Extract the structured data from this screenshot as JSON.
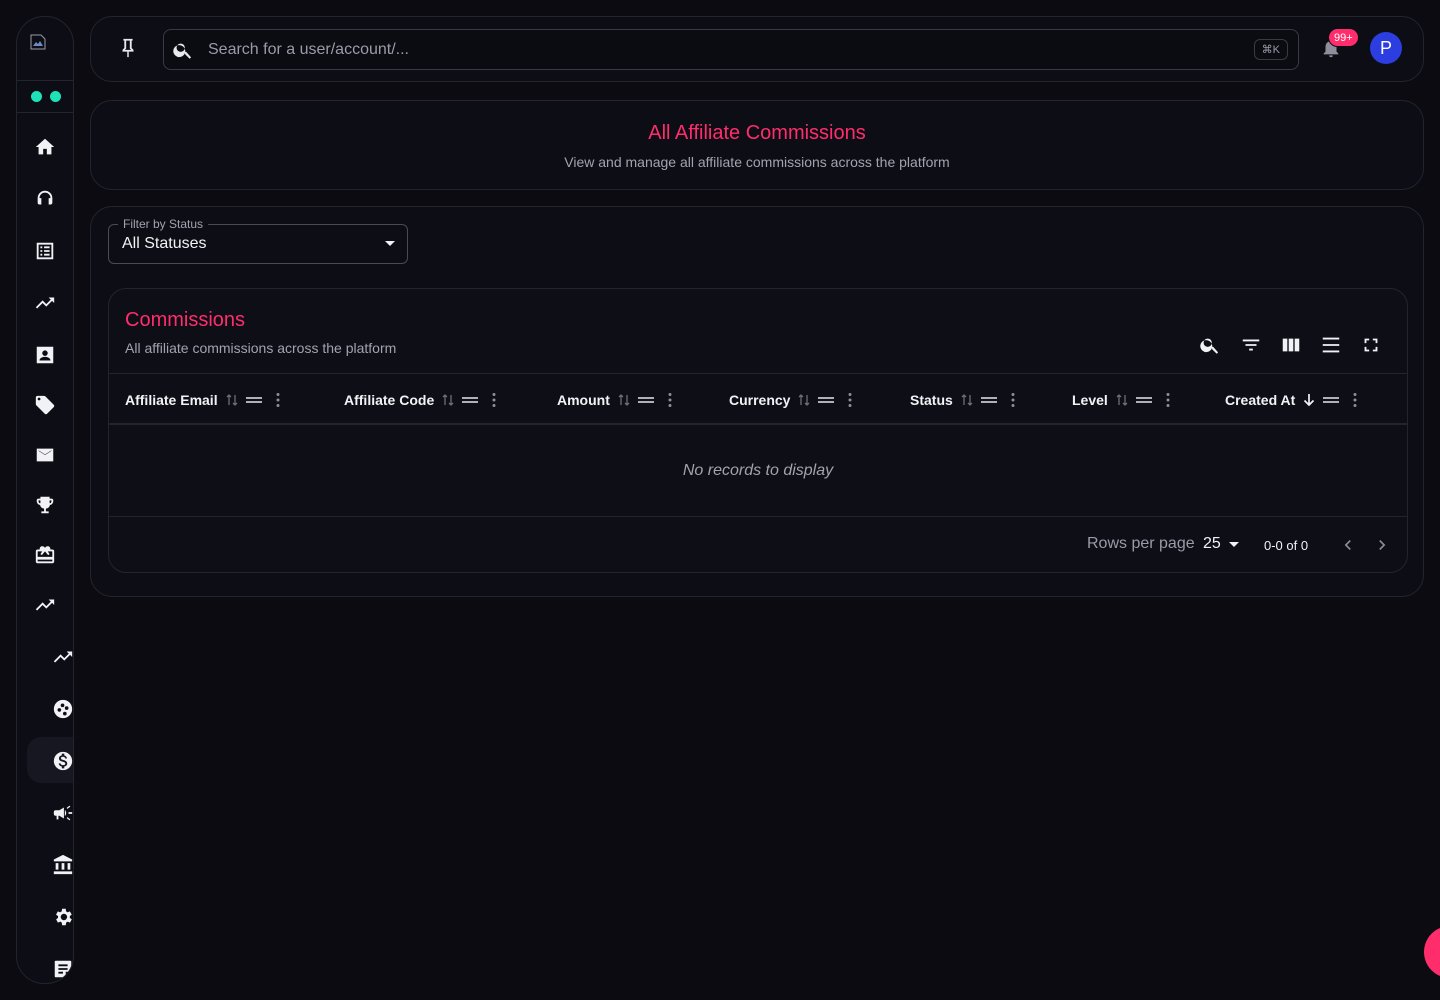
{
  "colors": {
    "accent": "#ff2d6b",
    "status_dots": "#1ee3b8",
    "avatar_bg": "#2d3ee0",
    "background": "#0b0b11"
  },
  "sidebar": {
    "logo_icon": "broken-image-icon",
    "items": [
      {
        "name": "home",
        "icon": "home-icon"
      },
      {
        "name": "support",
        "icon": "headset-icon"
      },
      {
        "name": "list",
        "icon": "list-icon"
      },
      {
        "name": "trending",
        "icon": "trending-up-icon"
      },
      {
        "name": "contacts",
        "icon": "contact-card-icon"
      },
      {
        "name": "tags",
        "icon": "tag-icon"
      },
      {
        "name": "mail",
        "icon": "mail-icon"
      },
      {
        "name": "trophy",
        "icon": "trophy-icon"
      },
      {
        "name": "gifts",
        "icon": "gift-card-icon"
      },
      {
        "name": "trending-2",
        "icon": "trending-up-icon"
      },
      {
        "name": "affiliate-trending",
        "icon": "trending-up-icon"
      },
      {
        "name": "affiliate-network",
        "icon": "network-circle-icon"
      },
      {
        "name": "affiliate-commissions",
        "icon": "dollar-circle-icon",
        "active": true
      },
      {
        "name": "campaigns",
        "icon": "megaphone-icon"
      },
      {
        "name": "bank",
        "icon": "bank-icon"
      },
      {
        "name": "settings",
        "icon": "gear-icon"
      },
      {
        "name": "notes",
        "icon": "note-icon"
      }
    ]
  },
  "topbar": {
    "search_placeholder": "Search for a user/account/...",
    "shortcut": "⌘K",
    "notification_count": "99+",
    "avatar_initial": "P"
  },
  "header": {
    "title": "All Affiliate Commissions",
    "subtitle": "View and manage all affiliate commissions across the platform"
  },
  "filter": {
    "label": "Filter by Status",
    "value": "All Statuses"
  },
  "table": {
    "title": "Commissions",
    "subtitle": "All affiliate commissions across the platform",
    "toolbar": [
      "search-icon",
      "filter-icon",
      "columns-icon",
      "density-icon",
      "fullscreen-icon"
    ],
    "columns": [
      {
        "label": "Affiliate Email",
        "sort": "none"
      },
      {
        "label": "Affiliate Code",
        "sort": "none"
      },
      {
        "label": "Amount",
        "sort": "none"
      },
      {
        "label": "Currency",
        "sort": "none"
      },
      {
        "label": "Status",
        "sort": "none"
      },
      {
        "label": "Level",
        "sort": "none"
      },
      {
        "label": "Created At",
        "sort": "desc"
      }
    ],
    "empty_text": "No records to display",
    "pagination": {
      "rows_label": "Rows per page",
      "rows_value": "25",
      "range": "0-0 of 0"
    }
  }
}
